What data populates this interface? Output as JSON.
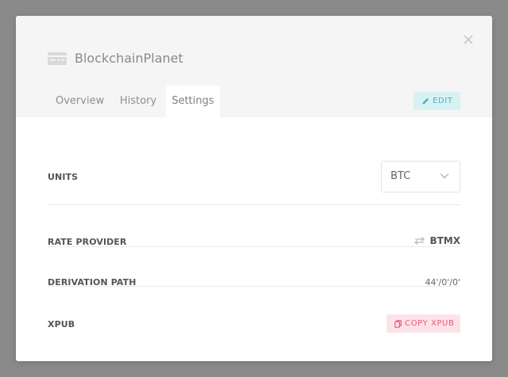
{
  "modal": {
    "account_name": "BlockchainPlanet",
    "tabs": [
      {
        "label": "Overview",
        "active": false
      },
      {
        "label": "History",
        "active": false
      },
      {
        "label": "Settings",
        "active": true
      }
    ],
    "edit_label": "EDIT"
  },
  "settings": {
    "units": {
      "label": "UNITS",
      "value": "BTC"
    },
    "rate_provider": {
      "label": "RATE PROVIDER",
      "value": "BTMX"
    },
    "derivation_path": {
      "label": "DERIVATION PATH",
      "value": "44'/0'/0'"
    },
    "xpub": {
      "label": "XPUB",
      "button_label": "COPY XPUB"
    }
  },
  "colors": {
    "header_bg": "#f5f5f5",
    "edit_accent": "#3fb8c2",
    "copy_accent": "#e85a78",
    "backdrop": "#8a8a8a"
  },
  "icons": [
    "close-icon",
    "account-card-icon",
    "pencil-icon",
    "chevron-down-icon",
    "swap-icon",
    "copy-icon"
  ]
}
